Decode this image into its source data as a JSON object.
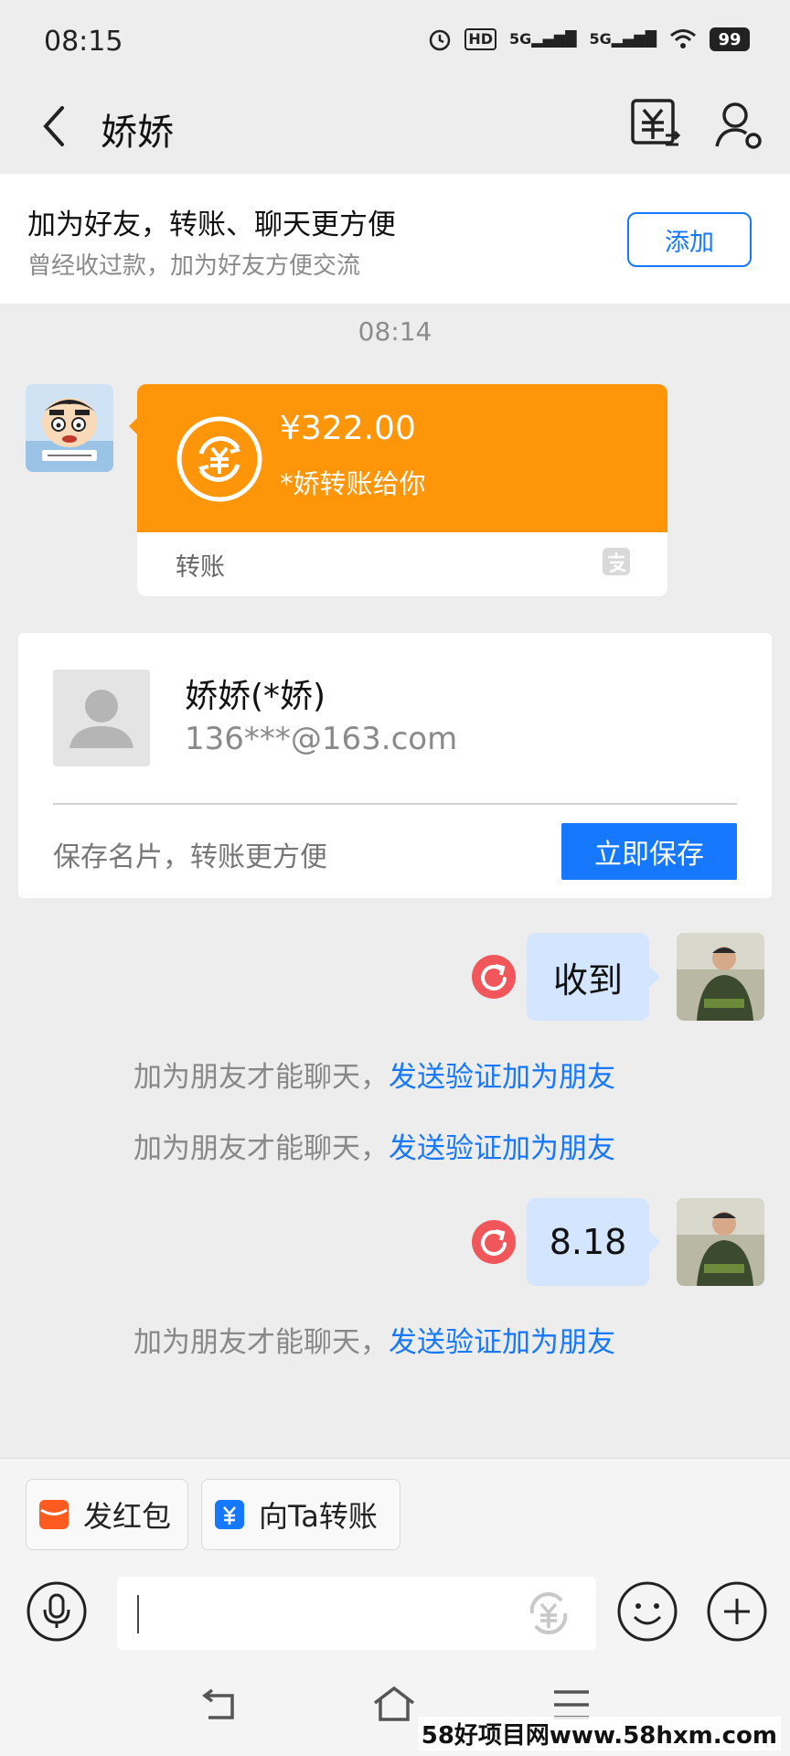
{
  "status": {
    "time": "08:15",
    "signal1": "5G",
    "signal2": "5G",
    "hd": "HD",
    "battery": "99"
  },
  "header": {
    "title": "娇娇"
  },
  "banner": {
    "title": "加为好友，转账、聊天更方便",
    "subtitle": "曾经收过款，加为好友方便交流",
    "add_label": "添加"
  },
  "timestamp": "08:14",
  "transfer_card": {
    "amount": "¥322.00",
    "note": "*娇转账给你",
    "label": "转账"
  },
  "contact_card": {
    "name": "娇娇(*娇)",
    "email": "136***@163.com",
    "hint": "保存名片，转账更方便",
    "save_label": "立即保存"
  },
  "messages": [
    {
      "text": "收到"
    },
    {
      "text": "8.18"
    }
  ],
  "notice": {
    "prefix": "加为朋友才能聊天，",
    "link": "发送验证加为朋友"
  },
  "quick_actions": [
    {
      "label": "发红包",
      "color": "#FF5A1F"
    },
    {
      "label": "向Ta转账",
      "color": "#1677FF"
    }
  ],
  "watermark": "58好项目网www.58hxm.com",
  "colors": {
    "accent": "#1677FF",
    "transfer_orange": "#FF9508",
    "bubble": "#D3E5FF",
    "error": "#F0565A"
  }
}
